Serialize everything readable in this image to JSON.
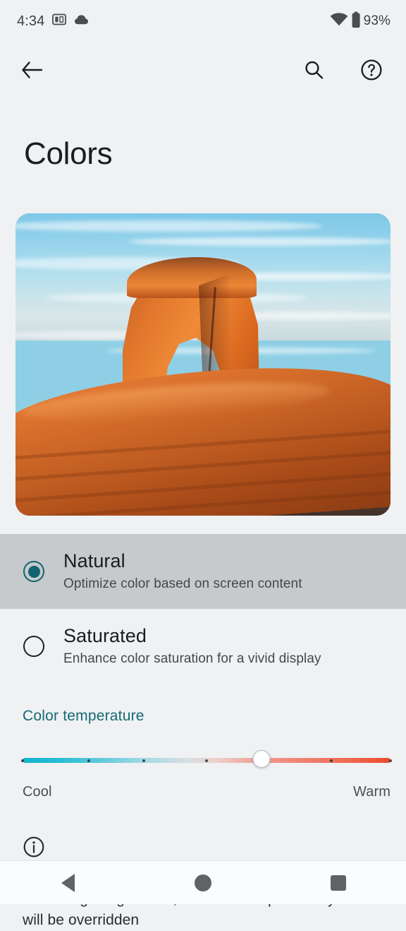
{
  "status_bar": {
    "time": "4:34",
    "battery_percent": "93%",
    "icons": [
      "screen-cast-icon",
      "cloud-icon",
      "wifi-icon",
      "battery-icon"
    ]
  },
  "action_bar": {
    "back_icon": "back-arrow-icon",
    "search_icon": "search-icon",
    "help_icon": "help-icon"
  },
  "header": {
    "title": "Colors"
  },
  "preview": {
    "alt": "Delicate Arch sandstone formation at sunset with snow-capped mountains"
  },
  "options": [
    {
      "title": "Natural",
      "subtitle": "Optimize color based on screen content",
      "selected": true
    },
    {
      "title": "Saturated",
      "subtitle": "Enhance color saturation for a vivid display",
      "selected": false
    }
  ],
  "color_temperature": {
    "label": "Color temperature",
    "min_label": "Cool",
    "max_label": "Warm",
    "value_percent": 65,
    "tick_percents": [
      0,
      18,
      33,
      50,
      66,
      84,
      100
    ],
    "cool_color": "#10b4cf",
    "warm_color": "#ec4a2c"
  },
  "footer_note": {
    "icon": "info-icon",
    "text": "When Night Light is on, the color temperature you set will be overridden"
  },
  "nav_bar": {
    "back_label": "Back",
    "home_label": "Home",
    "recents_label": "Recents"
  },
  "theme": {
    "background": "#eff1f3",
    "selected_row": "#c6cacd",
    "accent": "#12636f"
  }
}
